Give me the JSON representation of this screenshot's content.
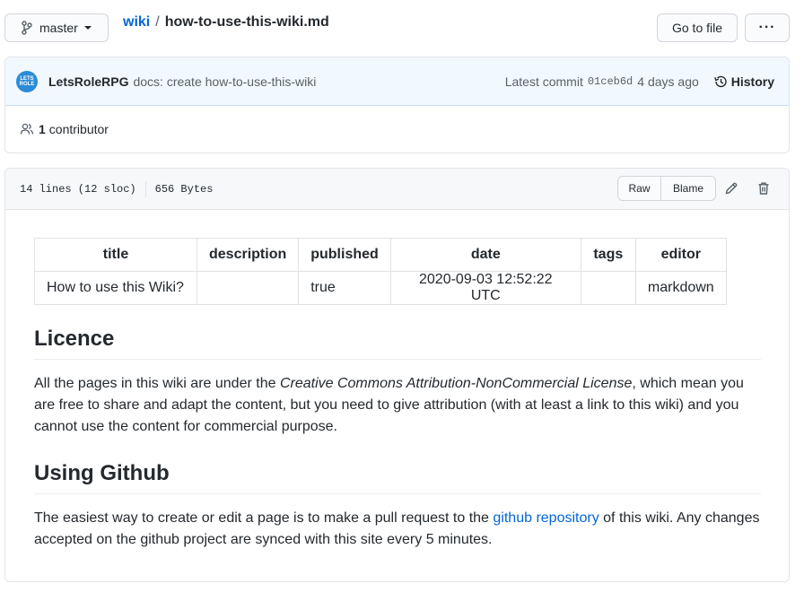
{
  "topbar": {
    "branch": "master",
    "repo_link": "wiki",
    "separator": "/",
    "file_name": "how-to-use-this-wiki.md",
    "goto_file": "Go to file",
    "more": "···"
  },
  "commit": {
    "avatar_text": "LETS ROLE",
    "author": "LetsRoleRPG",
    "message": "docs: create how-to-use-this-wiki",
    "latest_label": "Latest commit",
    "sha": "01ceb6d",
    "age": "4 days ago",
    "history": "History",
    "contributor_count": "1",
    "contributor_label": "contributor"
  },
  "file": {
    "lines": "14 lines (12 sloc)",
    "size": "656 Bytes",
    "raw": "Raw",
    "blame": "Blame"
  },
  "frontmatter": {
    "headers": [
      "title",
      "description",
      "published",
      "date",
      "tags",
      "editor"
    ],
    "row": [
      "How to use this Wiki?",
      "",
      "true",
      "2020-09-03 12:52:22 UTC",
      "",
      "markdown"
    ]
  },
  "sections": {
    "licence_heading": "Licence",
    "licence_pre": "All the pages in this wiki are under the ",
    "licence_em": "Creative Commons Attribution-NonCommercial License",
    "licence_post": ", which mean you are free to share and adapt the content, but you need to give attribution (with at least a link to this wiki) and you cannot use the content for commercial purpose.",
    "github_heading": "Using Github",
    "github_pre": "The easiest way to create or edit a page is to make a pull request to the ",
    "github_link": "github repository",
    "github_post": " of this wiki. Any changes accepted on the github project are synced with this site every 5 minutes."
  },
  "colors": {
    "link": "#0366d6",
    "commit_bg": "#f1f8ff",
    "avatar": "#2b8bd6"
  }
}
